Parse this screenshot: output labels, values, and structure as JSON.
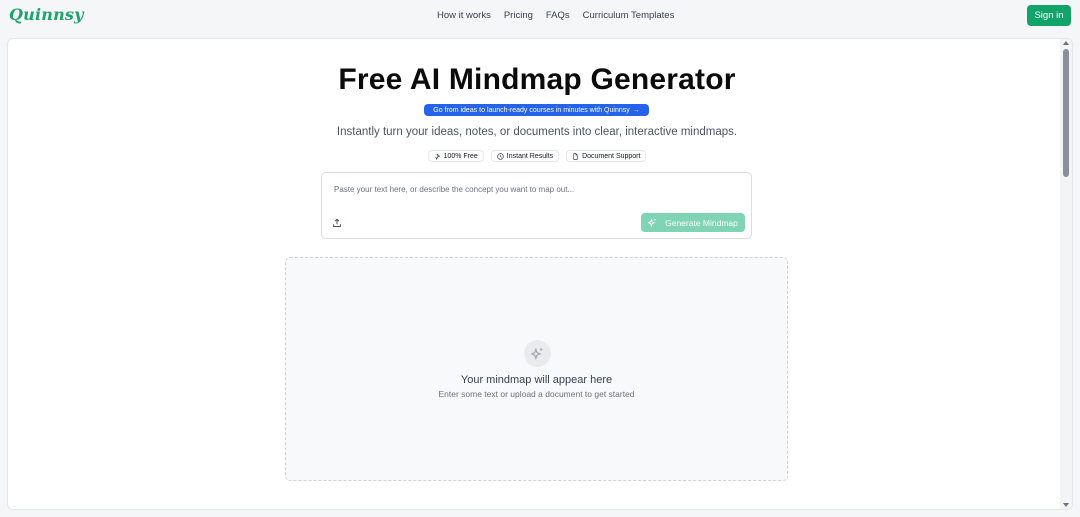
{
  "header": {
    "logo_text": "Quinnsy",
    "brand_color": "#1fa36b",
    "nav_items": [
      {
        "label": "How it works"
      },
      {
        "label": "Pricing"
      },
      {
        "label": "FAQs"
      },
      {
        "label": "Curriculum Templates"
      }
    ],
    "signin_label": "Sign in"
  },
  "hero": {
    "title": "Free AI Mindmap Generator",
    "promo_label": "Go from ideas to launch-ready courses in minutes with Quinnsy",
    "promo_arrow": "→",
    "subtitle": "Instantly turn your ideas, notes, or documents into clear, interactive mindmaps.",
    "features": [
      {
        "label": "100% Free",
        "icon": "sparkles-icon"
      },
      {
        "label": "Instant Results",
        "icon": "clock-icon"
      },
      {
        "label": "Document Support",
        "icon": "document-icon"
      }
    ]
  },
  "input": {
    "value": "",
    "placeholder": "Paste your text here, or describe the concept you want to map out...",
    "upload_icon": "upload-icon",
    "generate_label": "Generate Mindmap",
    "generate_color": "#7fd4b5"
  },
  "preview": {
    "icon": "sparkles-icon",
    "title": "Your mindmap will appear here",
    "subtitle": "Enter some text or upload a document to get started"
  },
  "colors": {
    "accent": "#12a36a",
    "promo": "#2563eb"
  }
}
